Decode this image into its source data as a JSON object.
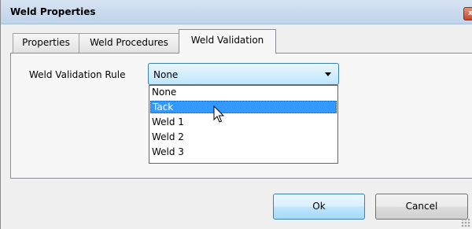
{
  "window": {
    "title": "Weld Properties",
    "close_glyph": "x"
  },
  "tabs": [
    {
      "label": "Properties",
      "active": false
    },
    {
      "label": "Weld Procedures",
      "active": false
    },
    {
      "label": "Weld Validation",
      "active": true
    }
  ],
  "validation": {
    "rule_label": "Weld Validation Rule",
    "selected_value": "None",
    "options": [
      "None",
      "Tack",
      "Weld 1",
      "Weld 2",
      "Weld 3"
    ],
    "highlighted_option": "Tack"
  },
  "buttons": {
    "ok_label": "Ok",
    "cancel_label": "Cancel"
  },
  "colors": {
    "accent": "#3399ff",
    "titlebar": "#c9dbef",
    "close": "#c9442a"
  }
}
